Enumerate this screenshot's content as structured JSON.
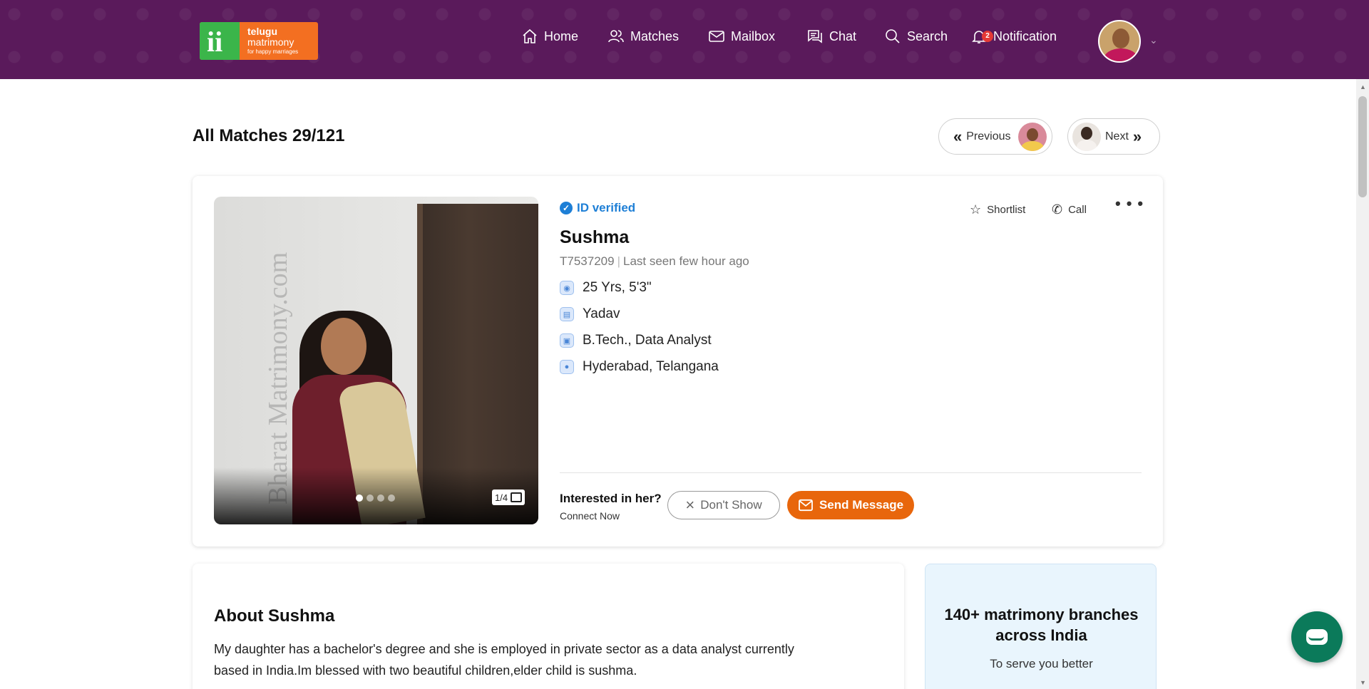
{
  "header": {
    "logo": {
      "line1": "telugu",
      "line2": "matrimony",
      "line3": "for happy marriages"
    },
    "nav": [
      {
        "label": "Home",
        "icon": "home-icon"
      },
      {
        "label": "Matches",
        "icon": "users-icon"
      },
      {
        "label": "Mailbox",
        "icon": "mail-icon"
      },
      {
        "label": "Chat",
        "icon": "chat-icon"
      },
      {
        "label": "Search",
        "icon": "search-icon"
      },
      {
        "label": "Notification",
        "icon": "bell-icon"
      }
    ],
    "notification_count": "2",
    "bg_color": "#5a1a5b"
  },
  "page": {
    "title": "All Matches 29/121",
    "previous_label": "Previous",
    "next_label": "Next"
  },
  "profile": {
    "verified_label": "ID verified",
    "name": "Sushma",
    "id": "T7537209",
    "last_seen": "Last seen few hour ago",
    "age_height": "25 Yrs, 5'3\"",
    "caste": "Yadav",
    "education_job": "B.Tech., Data Analyst",
    "location": "Hyderabad, Telangana",
    "photo_counter": "1/4",
    "photo_watermark": "Bharat Matrimony.com",
    "shortlist_label": "Shortlist",
    "call_label": "Call",
    "interested_label": "Interested in her?",
    "connect_label": "Connect Now",
    "dont_show_label": "Don't Show",
    "send_message_label": "Send Message",
    "accent_color": "#e8660c"
  },
  "about": {
    "title": "About Sushma",
    "text": "My daughter has a bachelor's degree and she is employed in private sector as a data analyst currently based in India.Im blessed with two beautiful children,elder child is sushma."
  },
  "branches": {
    "title": "140+ matrimony branches across India",
    "subtitle": "To serve you better"
  }
}
